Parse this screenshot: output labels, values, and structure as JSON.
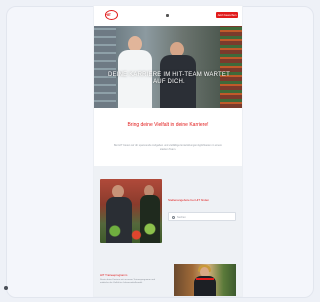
{
  "header": {
    "logo_text": "HIT",
    "cta_label": "Jetzt bewerben"
  },
  "hero": {
    "title": "Deine Karriere im HIT-Team wartet auf dich."
  },
  "intro": {
    "title": "Bring deine Vielfalt in deine Karriere!",
    "text": "Bei HIT bieten wir dir spannende Aufgaben und vielfältige Entwicklungsmöglichkeiten in einem starken Team."
  },
  "jobs": {
    "heading": "Stellenangebote bei HIT finden",
    "search_placeholder": "Suchen"
  },
  "section2": {
    "title": "HIT Traineeprogramm",
    "text": "Starte deine Karriere mit unserem Traineeprogramm und entdecke die Vielfalt im Lebensmittelhandel."
  },
  "colors": {
    "brand_red": "#e11a1a"
  }
}
